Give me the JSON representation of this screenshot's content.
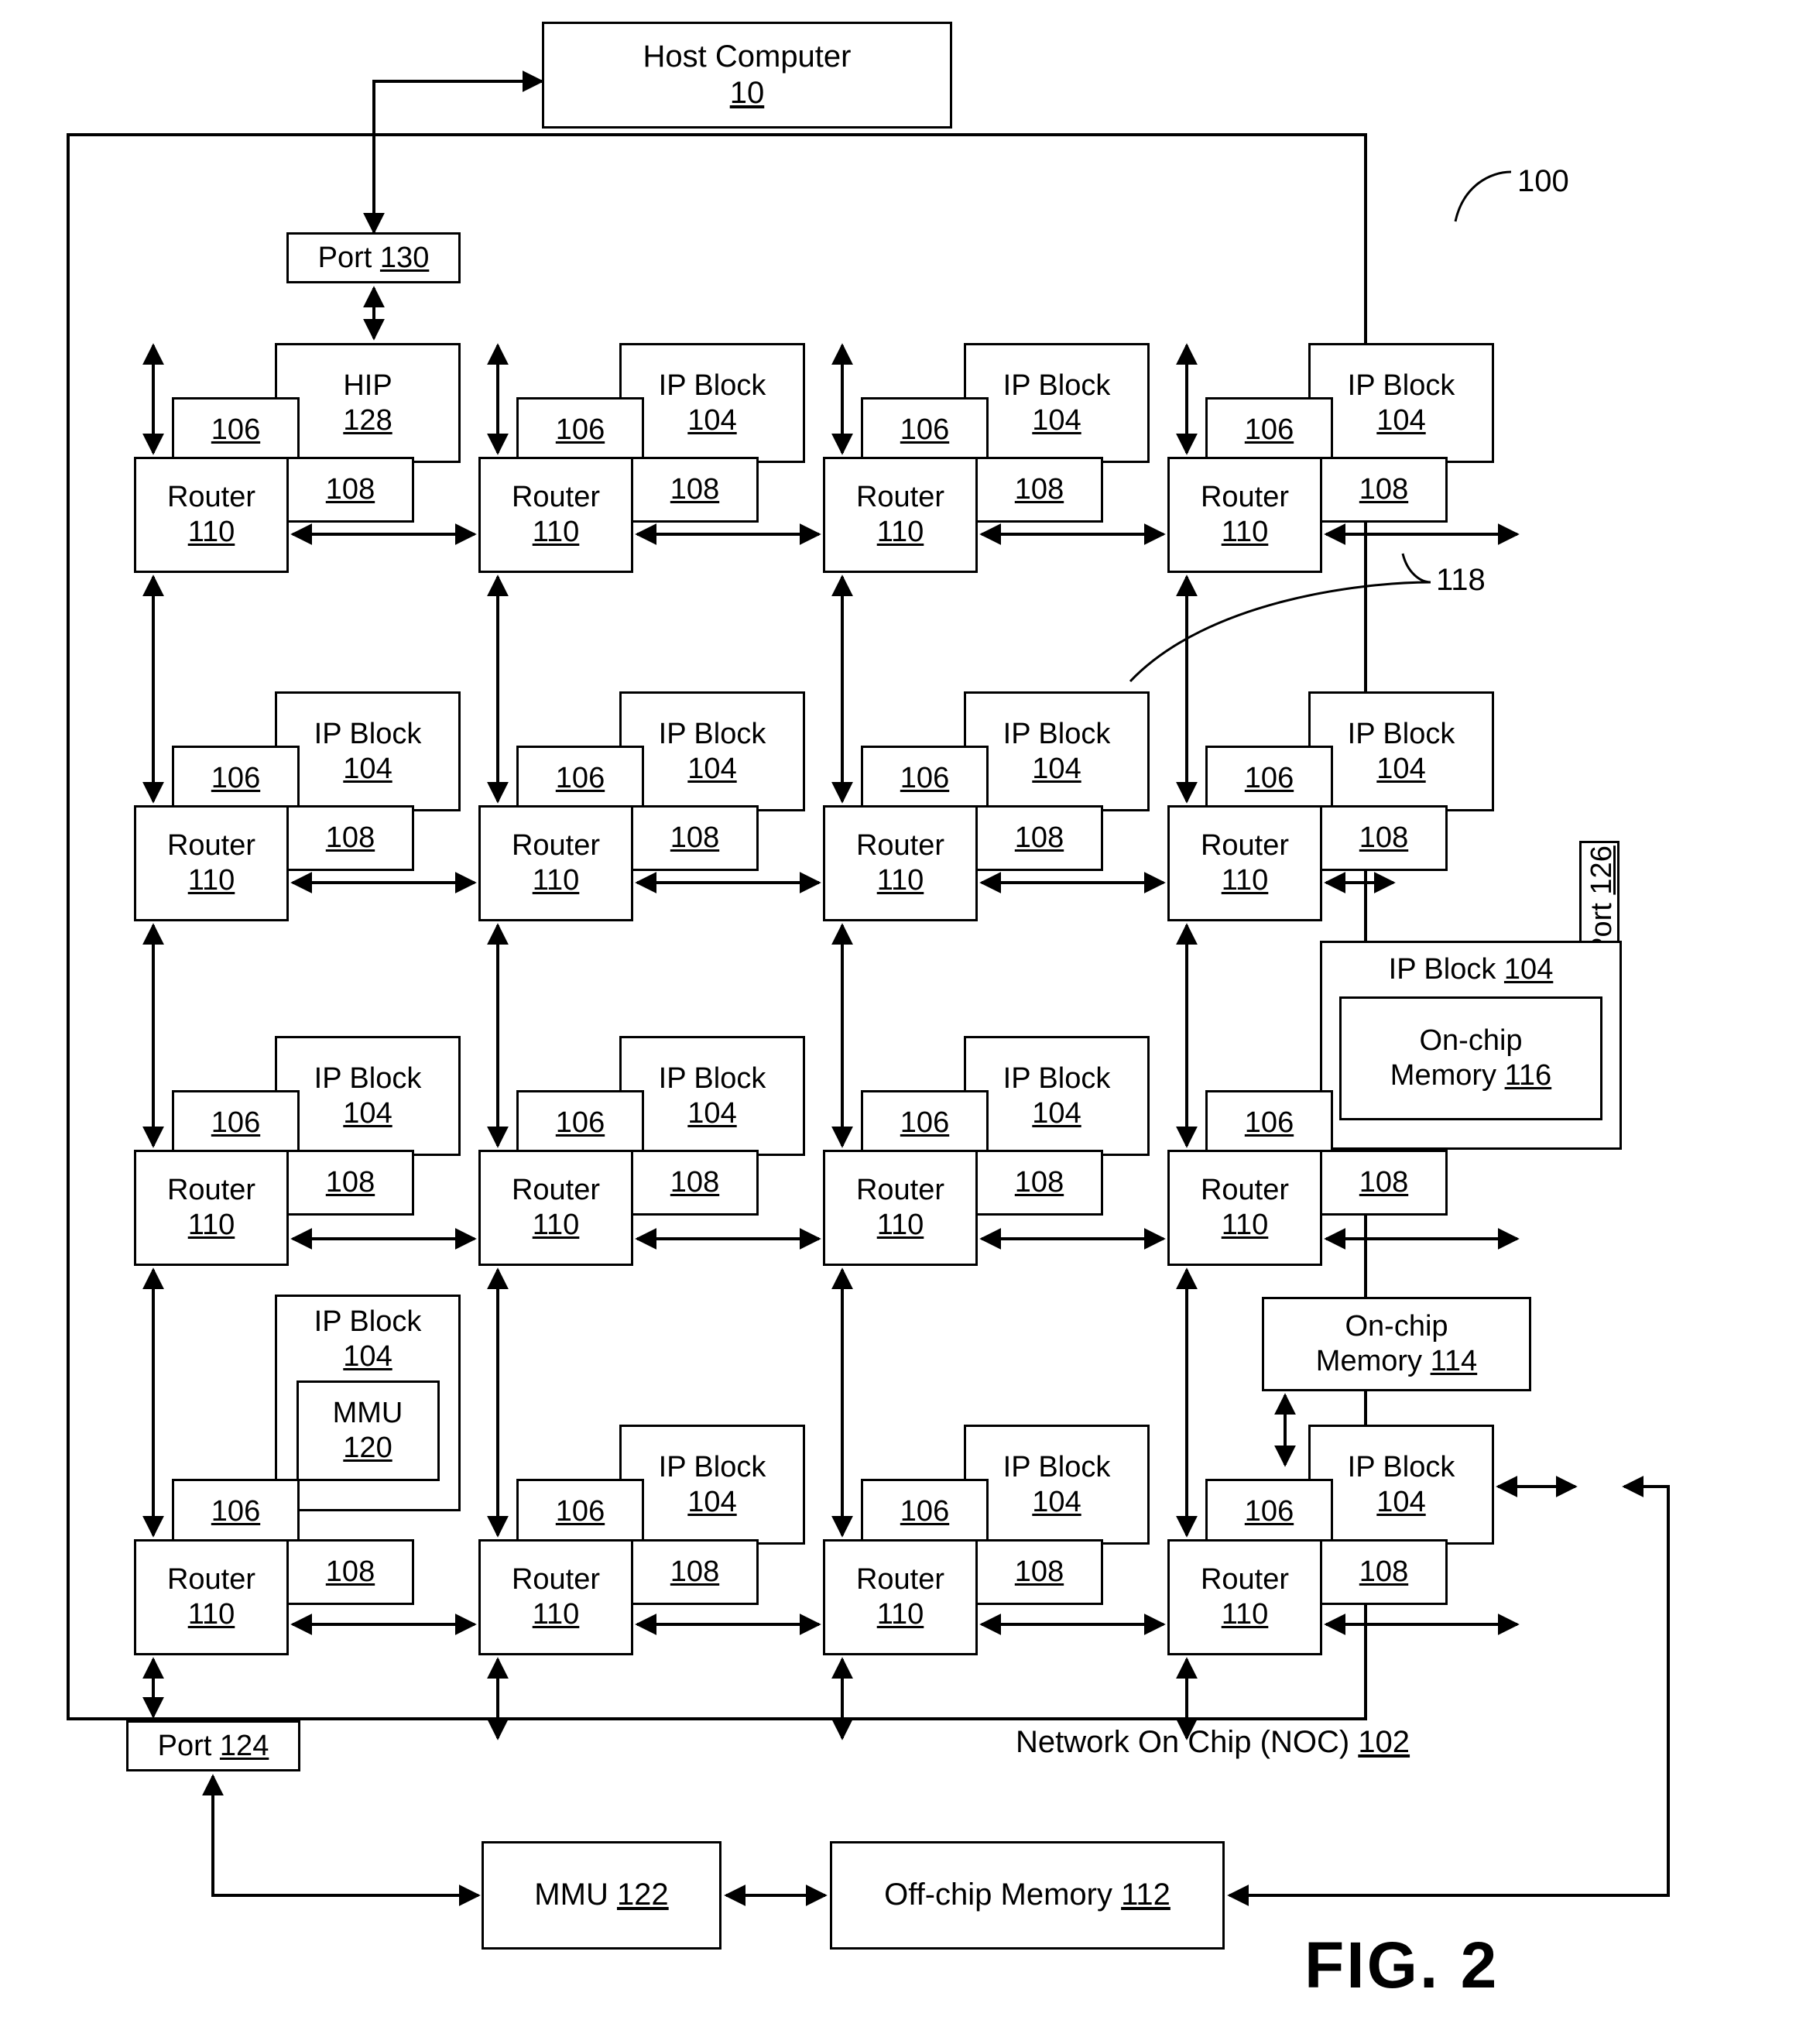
{
  "figure": {
    "caption": "FIG. 2",
    "system_ref": "100"
  },
  "host": {
    "label_text": "Host Computer ",
    "label_ref": "10"
  },
  "noc": {
    "label_text": "Network On Chip (NOC) ",
    "label_ref": "102",
    "link_ref": "118"
  },
  "ports": {
    "top": {
      "text": "Port ",
      "ref": "130"
    },
    "bottom": {
      "text": "Port ",
      "ref": "124"
    },
    "right": {
      "text": "Port ",
      "ref": "126"
    }
  },
  "external": {
    "mmu": {
      "text": "MMU ",
      "ref": "122"
    },
    "offchip": {
      "text": "Off-chip  Memory ",
      "ref": "112"
    }
  },
  "labels": {
    "router": "Router",
    "router_ref": "110",
    "memory_comm_ref": "106",
    "network_iface_ref": "108",
    "ip_block": "IP Block",
    "ip_block_ref": "104",
    "hip": "HIP",
    "hip_ref": "128",
    "onchip_memory": "On-chip",
    "onchip_memory2": "Memory ",
    "onchip_116_ref": "116",
    "onchip_114_ref": "114",
    "mmu_inner": "MMU",
    "mmu_inner_ref": "120"
  },
  "grid": {
    "rows": 4,
    "cols": 4,
    "tiles": [
      {
        "row": 1,
        "col": 1,
        "core_kind": "hip",
        "core_line1": "HIP",
        "core_ref": "128"
      },
      {
        "row": 1,
        "col": 2,
        "core_kind": "ip",
        "core_line1": "IP Block",
        "core_ref": "104"
      },
      {
        "row": 1,
        "col": 3,
        "core_kind": "ip",
        "core_line1": "IP Block",
        "core_ref": "104"
      },
      {
        "row": 1,
        "col": 4,
        "core_kind": "ip",
        "core_line1": "IP Block",
        "core_ref": "104"
      },
      {
        "row": 2,
        "col": 1,
        "core_kind": "ip",
        "core_line1": "IP Block",
        "core_ref": "104"
      },
      {
        "row": 2,
        "col": 2,
        "core_kind": "ip",
        "core_line1": "IP Block",
        "core_ref": "104"
      },
      {
        "row": 2,
        "col": 3,
        "core_kind": "ip",
        "core_line1": "IP Block",
        "core_ref": "104"
      },
      {
        "row": 2,
        "col": 4,
        "core_kind": "ip",
        "core_line1": "IP Block",
        "core_ref": "104"
      },
      {
        "row": 3,
        "col": 1,
        "core_kind": "ip",
        "core_line1": "IP Block",
        "core_ref": "104"
      },
      {
        "row": 3,
        "col": 2,
        "core_kind": "ip",
        "core_line1": "IP Block",
        "core_ref": "104"
      },
      {
        "row": 3,
        "col": 3,
        "core_kind": "ip",
        "core_line1": "IP Block",
        "core_ref": "104"
      },
      {
        "row": 3,
        "col": 4,
        "core_kind": "ip-memory",
        "core_line1": "IP Block",
        "core_ref": "104",
        "nested": "On-chip Memory 116"
      },
      {
        "row": 4,
        "col": 1,
        "core_kind": "ip-mmu",
        "core_line1": "IP Block",
        "core_ref": "104",
        "nested": "MMU 120"
      },
      {
        "row": 4,
        "col": 2,
        "core_kind": "ip",
        "core_line1": "IP Block",
        "core_ref": "104"
      },
      {
        "row": 4,
        "col": 3,
        "core_kind": "ip",
        "core_line1": "IP Block",
        "core_ref": "104"
      },
      {
        "row": 4,
        "col": 4,
        "core_kind": "ip",
        "core_line1": "IP Block",
        "core_ref": "104"
      }
    ]
  }
}
